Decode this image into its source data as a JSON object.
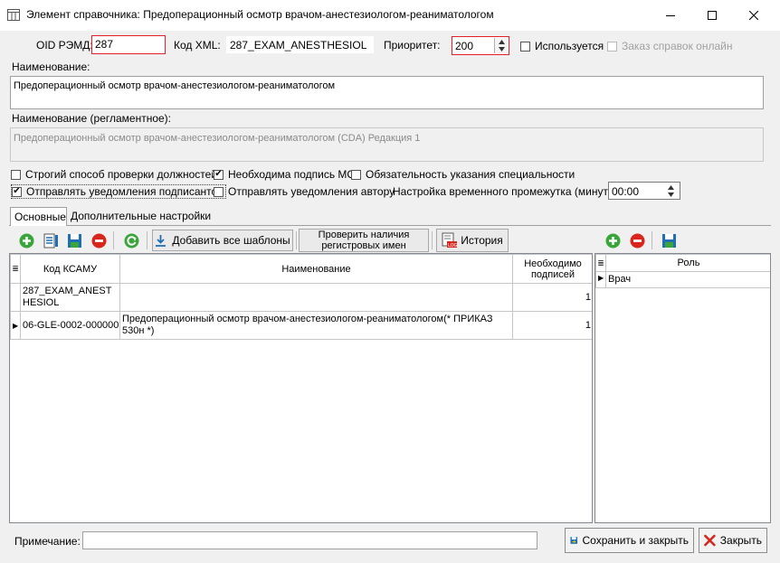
{
  "window": {
    "title": "Элемент справочника: Предоперационный осмотр врачом-анестезиологом-реаниматологом"
  },
  "header": {
    "oid_label": "OID РЭМД:",
    "oid_value": "287",
    "xml_label": "Код XML:",
    "xml_value": "287_EXAM_ANESTHESIOL",
    "priority_label": "Приоритет:",
    "priority_value": "200",
    "used_label": "Используется",
    "online_label": "Заказ справок онлайн"
  },
  "name": {
    "label": "Наименование:",
    "value": "Предоперационный осмотр врачом-анестезиологом-реаниматологом"
  },
  "reg_name": {
    "label": "Наименование (регламентное):",
    "value": "Предоперационный осмотр врачом-анестезиологом-реаниматологом (CDA) Редакция 1"
  },
  "options": {
    "strict_check": {
      "label": "Строгий способ проверки должностей",
      "checked": false
    },
    "need_mo_sign": {
      "label": "Необходима подпись МО",
      "checked": true
    },
    "specialty_required": {
      "label": "Обязательность указания специальности",
      "checked": false
    },
    "notify_signers": {
      "label": "Отправлять уведомления подписантов",
      "checked": true
    },
    "notify_author": {
      "label": "Отправлять уведомления автору",
      "checked": false
    },
    "time_label": "Настройка временного промежутка (минуты):",
    "time_value": "00:00"
  },
  "tabs": [
    {
      "label": "Основные",
      "active": true
    },
    {
      "label": "Дополнительные настройки",
      "active": false
    }
  ],
  "toolbar": {
    "add_templates": "Добавить все шаблоны",
    "check_names": "Проверить наличия регистровых имен",
    "history": "История"
  },
  "main_grid": {
    "columns": [
      "Код КСАМУ",
      "Наименование",
      "Необходимо подписей"
    ],
    "rows": [
      {
        "code": "287_EXAM_ANESTHESIOL",
        "name": "",
        "count": "1"
      },
      {
        "code": "06-GLE-0002-000000",
        "name": "Предоперационный осмотр врачом-анестезиологом-реаниматологом(* ПРИКАЗ 530н *)",
        "count": "1"
      }
    ]
  },
  "role_grid": {
    "column": "Роль",
    "rows": [
      "Врач"
    ]
  },
  "footer": {
    "note_label": "Примечание:",
    "note_value": "",
    "save_close": "Сохранить и закрыть",
    "close": "Закрыть"
  },
  "colors": {
    "error_border": "#e3202a",
    "add_green": "#3aa53a",
    "remove_red": "#d9261c",
    "save_blue": "#1f6fb5"
  }
}
